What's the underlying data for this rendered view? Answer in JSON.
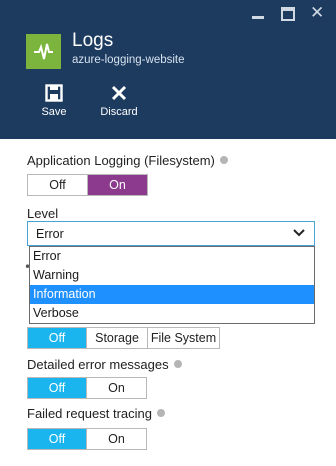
{
  "blade": {
    "title": "Logs",
    "subtitle": "azure-logging-website",
    "toolbar": {
      "save_label": "Save",
      "discard_label": "Discard"
    }
  },
  "app_logging": {
    "label": "Application Logging (Filesystem)",
    "off_label": "Off",
    "on_label": "On",
    "selected": "On"
  },
  "level": {
    "label": "Level",
    "value": "Error",
    "options": [
      "Error",
      "Warning",
      "Information",
      "Verbose"
    ],
    "highlighted": "Information"
  },
  "web_server_logging": {
    "options": [
      "Off",
      "Storage",
      "File System"
    ],
    "selected": "Off"
  },
  "detailed_errors": {
    "label": "Detailed error messages",
    "off_label": "Off",
    "on_label": "On",
    "selected": "Off"
  },
  "failed_request_tracing": {
    "label": "Failed request tracing",
    "off_label": "Off",
    "on_label": "On",
    "selected": "Off"
  },
  "colors": {
    "header_bg": "#1d3a5f",
    "app_icon": "#7bb53d",
    "toggle_on_purple": "#8c3a8e",
    "toggle_on_blue": "#1ab4ef",
    "dropdown_highlight": "#1e90ff"
  }
}
